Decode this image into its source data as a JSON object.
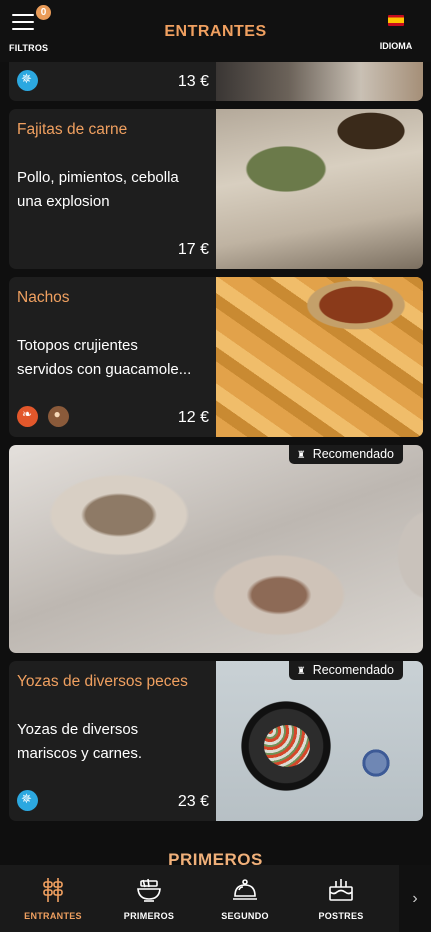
{
  "header": {
    "menu_label": "FILTROS",
    "filter_count": "0",
    "title": "ENTRANTES",
    "language_label": "IDIOMA"
  },
  "dishes": [
    {
      "name": "",
      "description": [],
      "price": "13 €",
      "allergens": [
        "crustacean"
      ]
    },
    {
      "name": "Fajitas de carne",
      "description": [
        "Pollo, pimientos, cebolla",
        "una explosion"
      ],
      "price": "17 €",
      "allergens": []
    },
    {
      "name": "Nachos",
      "description": [
        "Totopos crujientes",
        "servidos con guacamole..."
      ],
      "price": "12 €",
      "allergens": [
        "celery",
        "peanut"
      ]
    },
    {
      "name": "Yozas de diversos peces",
      "description": [
        "Yozas de diversos",
        "mariscos y carnes."
      ],
      "price": "23 €",
      "allergens": [
        "crustacean"
      ]
    }
  ],
  "recommended_label": "Recomendado",
  "next_section_title": "PRIMEROS",
  "tabs": [
    {
      "label": "ENTRANTES",
      "icon": "skewers-icon",
      "active": true
    },
    {
      "label": "PRIMEROS",
      "icon": "soup-bowl-icon",
      "active": false
    },
    {
      "label": "SEGUNDO",
      "icon": "cloche-icon",
      "active": false
    },
    {
      "label": "POSTRES",
      "icon": "cake-icon",
      "active": false
    }
  ],
  "colors": {
    "accent": "#f0a060",
    "background": "#0f0f0f",
    "card": "#1e1e1e",
    "crustacean_badge": "#2ca8e0",
    "celery_badge": "#e2572b"
  }
}
